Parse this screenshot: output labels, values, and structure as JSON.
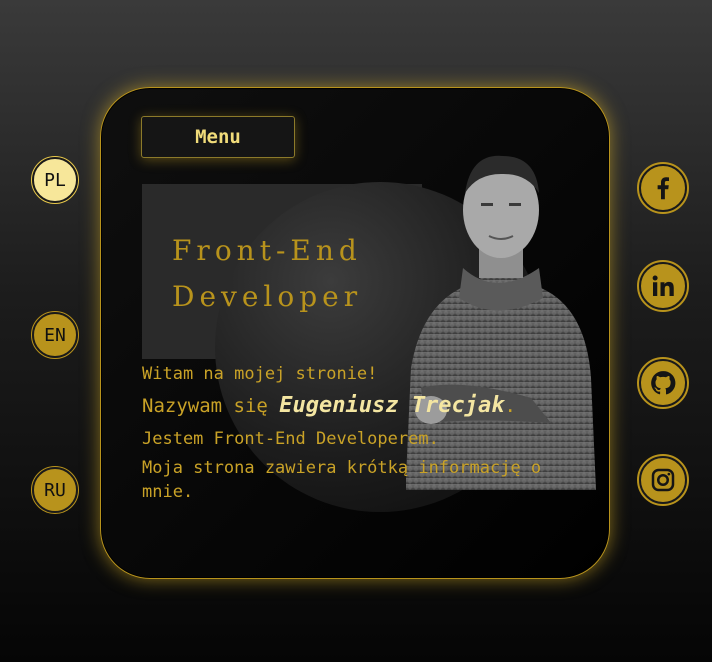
{
  "languages": [
    {
      "code": "PL",
      "active": true
    },
    {
      "code": "EN",
      "active": false
    },
    {
      "code": "RU",
      "active": false
    }
  ],
  "menu": {
    "label": "Menu"
  },
  "hero": {
    "title_line1": "Front-End",
    "title_line2": "Developer"
  },
  "intro": {
    "line1": "Witam na mojej stronie!",
    "line2_prefix": "Nazywam się ",
    "name": "Eugeniusz Trecjak",
    "line2_suffix": ".",
    "line3": "Jestem Front-End Developerem.",
    "line4": "Moja strona zawiera krótką informację o mnie."
  },
  "social": [
    "facebook-icon",
    "linkedin-icon",
    "github-icon",
    "instagram-icon"
  ],
  "colors": {
    "accent": "#b8931c",
    "accent_light": "#f7e79a",
    "text_gold": "#c9a227",
    "card_bg": "#0a0a0a"
  }
}
